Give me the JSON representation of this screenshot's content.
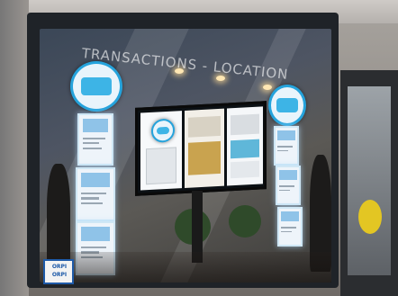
{
  "scene": {
    "window_lettering": "TRANSACTIONS - LOCATION",
    "sticker": {
      "line1": "ORPI",
      "line2": "ORPI"
    }
  },
  "colors": {
    "brand_blue": "#25a3dc",
    "frame": "#1f2328",
    "door_disc": "#e3c623"
  }
}
